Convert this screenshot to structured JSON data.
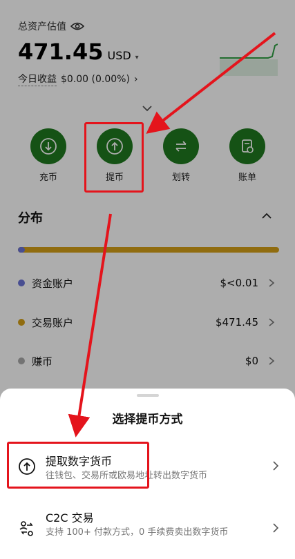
{
  "asset": {
    "label": "总资产估值",
    "total": "471.45",
    "currency": "USD",
    "today_label": "今日收益",
    "today_value": "$0.00 (0.00%)"
  },
  "actions": [
    {
      "label": "充币",
      "icon": "deposit-icon"
    },
    {
      "label": "提币",
      "icon": "withdraw-icon"
    },
    {
      "label": "划转",
      "icon": "transfer-icon"
    },
    {
      "label": "账单",
      "icon": "bill-icon"
    }
  ],
  "distribution": {
    "title": "分布",
    "accounts": [
      {
        "name": "资金账户",
        "value": "$<0.01",
        "color": "#6b73d6"
      },
      {
        "name": "交易账户",
        "value": "$471.45",
        "color": "#d4a017"
      },
      {
        "name": "赚币",
        "value": "$0",
        "color": "#aaaaaa"
      }
    ]
  },
  "sheet": {
    "title": "选择提币方式",
    "options": [
      {
        "title": "提取数字货币",
        "desc": "往钱包、交易所或欧易地址转出数字货币",
        "icon": "withdraw-circle-icon"
      },
      {
        "title": "C2C 交易",
        "desc": "支持 100+ 付款方式，0 手续费卖出数字货币",
        "icon": "c2c-icon"
      }
    ]
  },
  "colors": {
    "accent_green": "#1f7a1f",
    "annotation_red": "#e4141c"
  }
}
